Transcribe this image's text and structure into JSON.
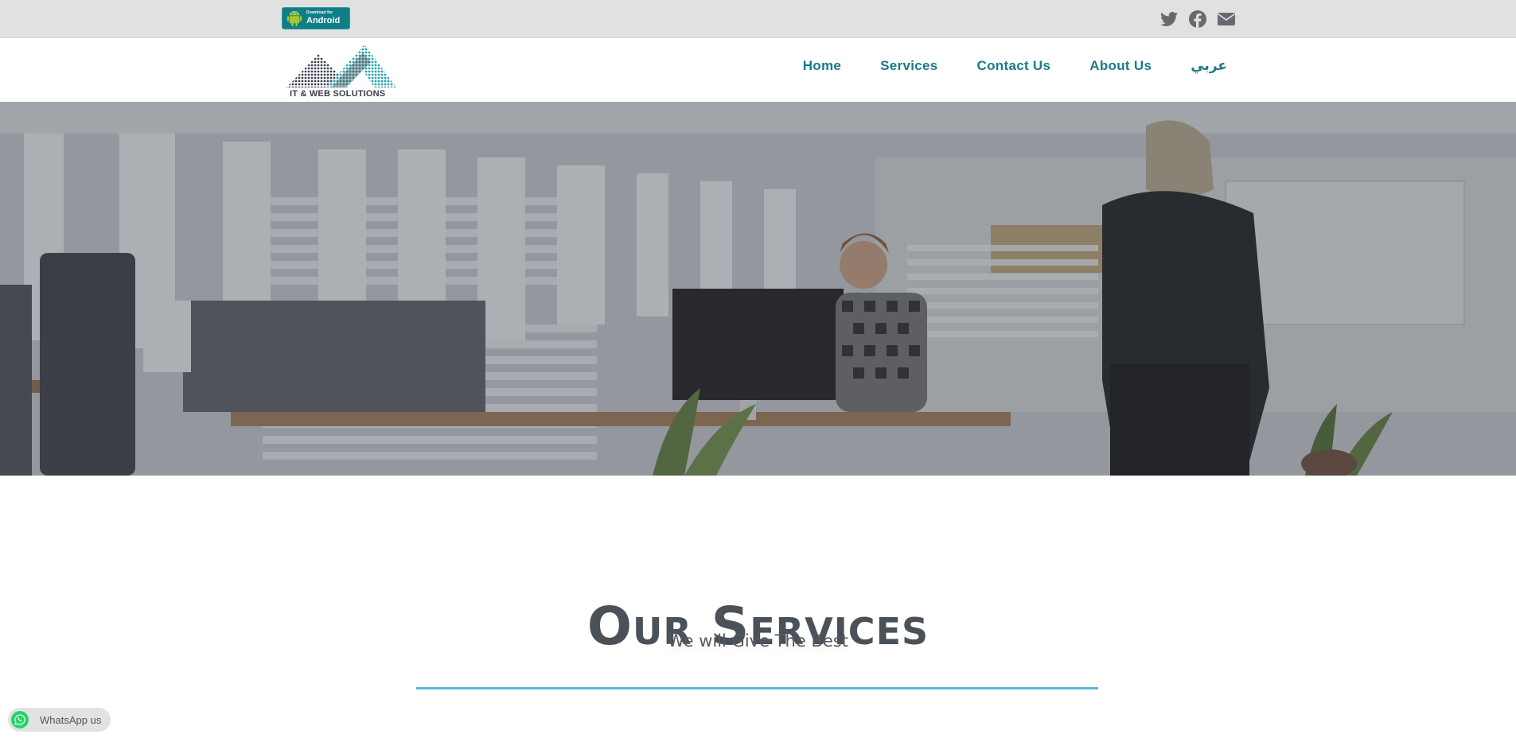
{
  "topbar": {
    "android_badge": {
      "small_text": "Download for",
      "big_text": "Android"
    },
    "social_icons": [
      "twitter-icon",
      "facebook-icon",
      "envelope-icon"
    ]
  },
  "header": {
    "logo_text": "IT & WEB SOLUTIONS",
    "nav": [
      {
        "label": "Home"
      },
      {
        "label": "Services"
      },
      {
        "label": "Contact Us"
      },
      {
        "label": "About Us"
      },
      {
        "label": "عربي"
      }
    ]
  },
  "services": {
    "title": "Our Services",
    "subtitle": "We will Give The Best"
  },
  "whatsapp": {
    "label": "WhatsApp us"
  },
  "colors": {
    "brand_teal": "#1b7a86",
    "divider_blue": "#5fb9d9",
    "whatsapp_green": "#25d366"
  }
}
